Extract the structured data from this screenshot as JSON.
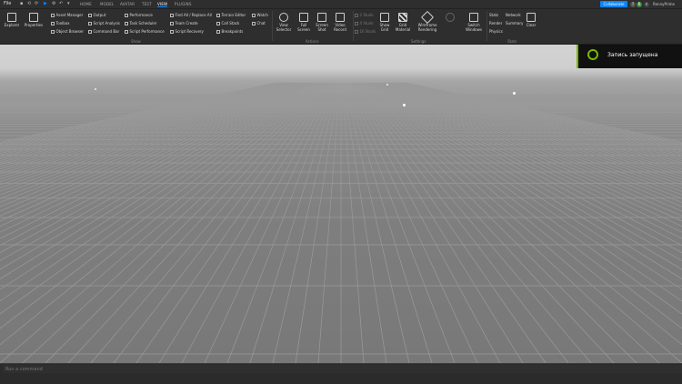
{
  "app": {
    "logo": "File"
  },
  "menu_tabs": [
    "HOME",
    "MODEL",
    "AVATAR",
    "TEST",
    "VIEW",
    "PLUGINS"
  ],
  "active_tab": "VIEW",
  "topbar": {
    "collaborate": "Collaborate",
    "user": "RonnyPrime"
  },
  "ribbon": {
    "explorer": "Explorer",
    "properties": "Properties",
    "show_col1": [
      "Asset Manager",
      "Toolbox",
      "Object Browser"
    ],
    "show_col2": [
      "Output",
      "Script Analysis",
      "Command Bar"
    ],
    "show_col3": [
      "Performance",
      "Task Scheduler",
      "Script Performance"
    ],
    "show_col4": [
      "Find All / Replace All",
      "Team Create",
      "Script Recovery"
    ],
    "show_col5": [
      "Terrain Editor",
      "Call Stack",
      "Breakpoints"
    ],
    "show_col6": [
      "Watch",
      "Chat"
    ],
    "show_group": "Show",
    "actions": [
      "View Selector",
      "Full Screen",
      "Screen Shot",
      "Video Record"
    ],
    "actions_group": "Actions",
    "studs": [
      "2 Studs",
      "4 Studs",
      "16 Studs"
    ],
    "settings": [
      "Show Grid",
      "Grid Material",
      "Wireframe Rendering"
    ],
    "switch_windows": "Switch Windows",
    "settings_group": "Settings",
    "stats_col1": [
      "Stats",
      "Render",
      "Physics"
    ],
    "stats_col2": [
      "Network",
      "Summary"
    ],
    "clear": "Clear",
    "stats_group": "Stats"
  },
  "toast": {
    "text": "Запись запущена"
  },
  "command_bar": {
    "placeholder": "Run a command"
  },
  "colors": {
    "accent": "#0a84ff",
    "nvidia": "#76b900"
  }
}
